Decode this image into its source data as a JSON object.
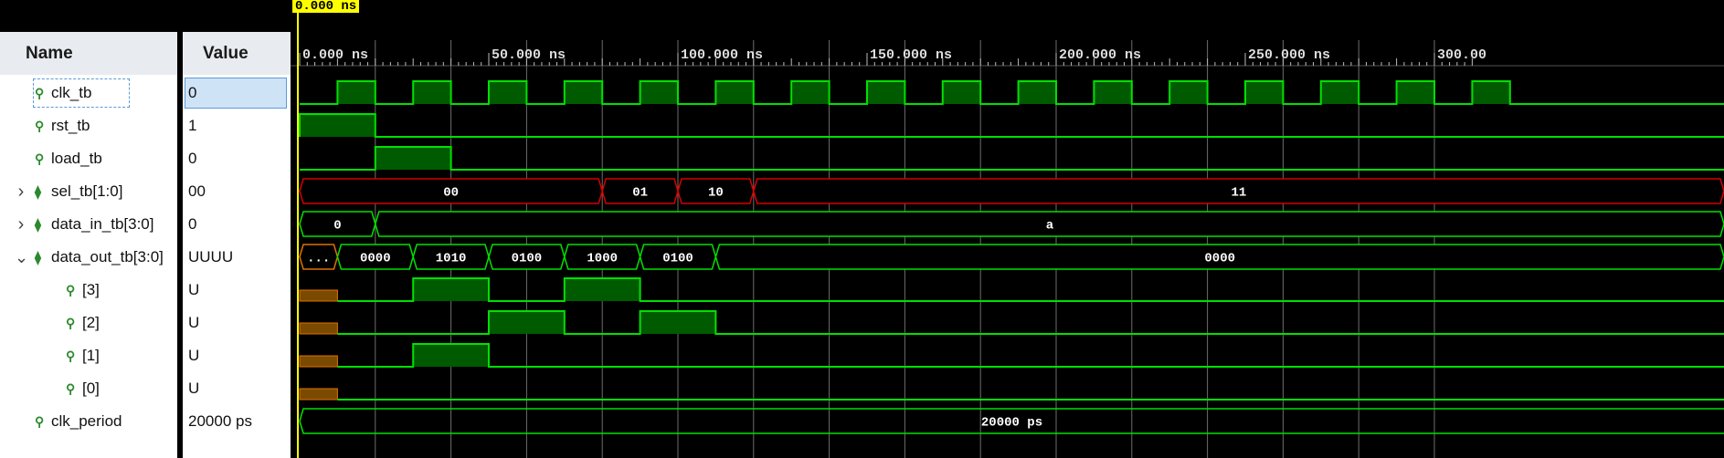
{
  "cursor_time": "0.000 ns",
  "header": {
    "name_col": "Name",
    "value_col": "Value"
  },
  "signals": [
    {
      "name": "clk_tb",
      "value": "0",
      "expand": "",
      "icon": "bit-icon"
    },
    {
      "name": "rst_tb",
      "value": "1",
      "expand": "",
      "icon": "bit-icon"
    },
    {
      "name": "load_tb",
      "value": "0",
      "expand": "",
      "icon": "bit-icon"
    },
    {
      "name": "sel_tb[1:0]",
      "value": "00",
      "expand": ">",
      "icon": "bus-icon"
    },
    {
      "name": "data_in_tb[3:0]",
      "value": "0",
      "expand": ">",
      "icon": "bus-icon"
    },
    {
      "name": "data_out_tb[3:0]",
      "value": "UUUU",
      "expand": "v",
      "icon": "bus-icon"
    },
    {
      "name": "[3]",
      "value": "U",
      "expand": "",
      "icon": "bit-icon"
    },
    {
      "name": "[2]",
      "value": "U",
      "expand": "",
      "icon": "bit-icon"
    },
    {
      "name": "[1]",
      "value": "U",
      "expand": "",
      "icon": "bit-icon"
    },
    {
      "name": "[0]",
      "value": "U",
      "expand": "",
      "icon": "bit-icon"
    },
    {
      "name": "clk_period",
      "value": "20000 ps",
      "expand": "",
      "icon": "bit-icon"
    }
  ],
  "time_axis": {
    "labels": [
      "0.000 ns",
      "50.000 ns",
      "100.000 ns",
      "150.000 ns",
      "200.000 ns",
      "250.000 ns",
      "300.00"
    ],
    "label_times_ns": [
      0,
      50,
      100,
      150,
      200,
      250,
      300
    ]
  },
  "waves": {
    "clk_period_ns": 20,
    "clk_start_level": 0,
    "clk_first_edge_ns": 10,
    "rst_high": [
      [
        0,
        20
      ]
    ],
    "load_high": [
      [
        20,
        40
      ]
    ],
    "sel_tb": [
      {
        "start": 0,
        "end": 80,
        "label": "00"
      },
      {
        "start": 80,
        "end": 100,
        "label": "01"
      },
      {
        "start": 100,
        "end": 120,
        "label": "10"
      },
      {
        "start": 120,
        "end": 999,
        "label": "11"
      }
    ],
    "data_in_tb": [
      {
        "start": 0,
        "end": 20,
        "label": "0"
      },
      {
        "start": 20,
        "end": 999,
        "label": "a"
      }
    ],
    "data_out_tb": [
      {
        "start": 0,
        "end": 10,
        "label": "...",
        "unknown": true
      },
      {
        "start": 10,
        "end": 30,
        "label": "0000"
      },
      {
        "start": 30,
        "end": 50,
        "label": "1010"
      },
      {
        "start": 50,
        "end": 70,
        "label": "0100"
      },
      {
        "start": 70,
        "end": 90,
        "label": "1000"
      },
      {
        "start": 90,
        "end": 110,
        "label": "0100"
      },
      {
        "start": 110,
        "end": 999,
        "label": "0000"
      }
    ],
    "bit3_high": [
      [
        30,
        50
      ],
      [
        70,
        90
      ]
    ],
    "bit2_high": [
      [
        50,
        70
      ],
      [
        90,
        110
      ]
    ],
    "bit1_high": [
      [
        30,
        50
      ]
    ],
    "bit0_high": [],
    "undefined_until_ns": 10,
    "clk_period_value": "20000 ps"
  },
  "colors": {
    "wave": "#00e000",
    "fill": "#005a00",
    "bus_red": "#d40000",
    "unknown_orange": "#e07000",
    "unknown_fill": "#7a4a00",
    "cursor": "#ffff00",
    "grid": "#6e6e6e"
  }
}
